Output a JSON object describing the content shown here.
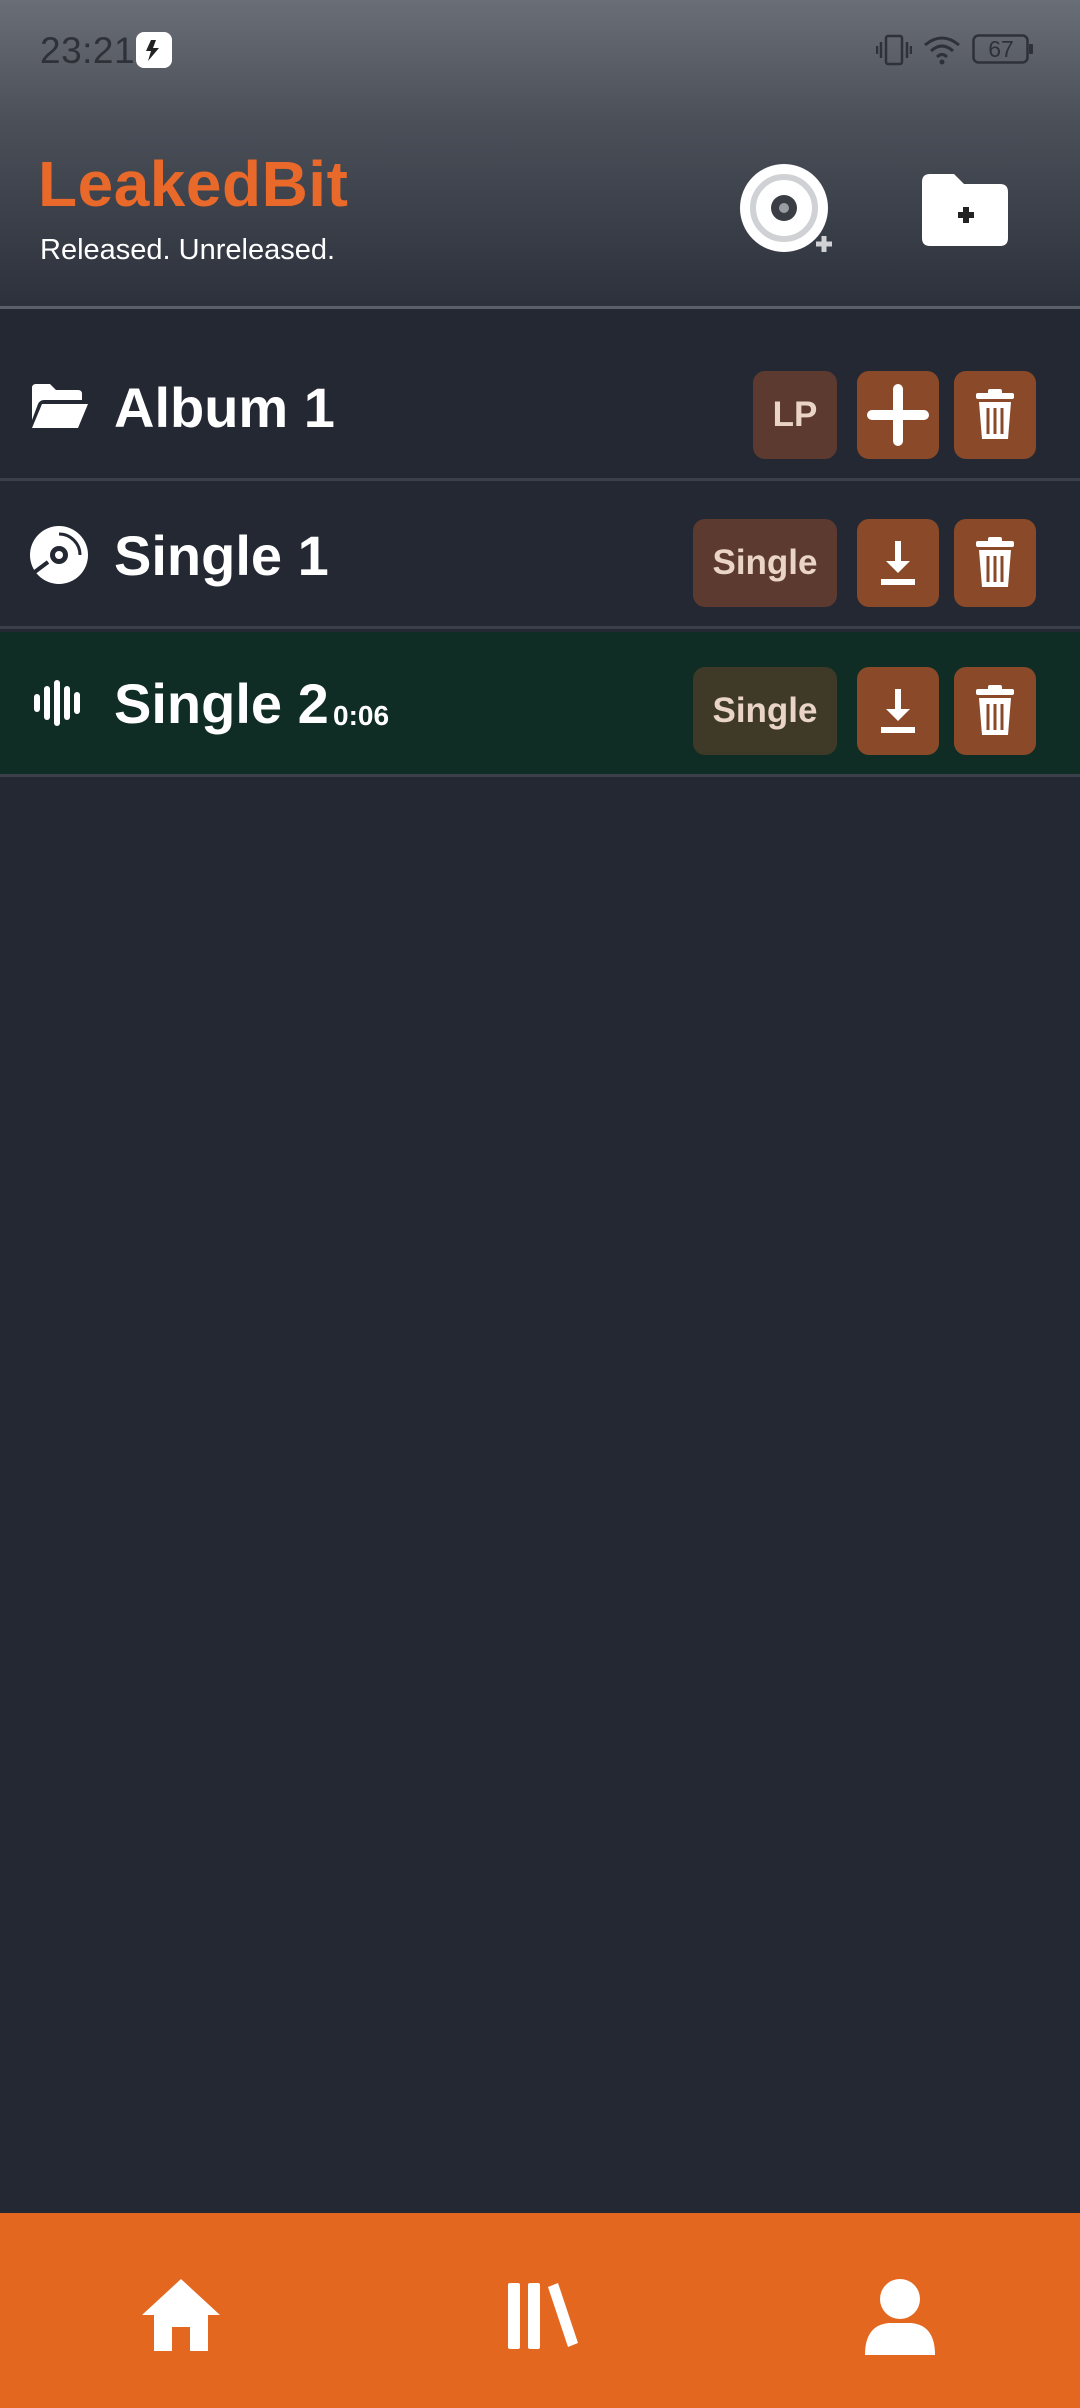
{
  "status_bar": {
    "time": "23:21",
    "battery": "67",
    "icons": [
      "app-notification-icon",
      "vibrate-icon",
      "wifi-icon",
      "battery-icon"
    ]
  },
  "header": {
    "title": "LeakedBit",
    "subtitle": "Released. Unreleased.",
    "actions": [
      "add-disc-icon",
      "add-folder-icon"
    ]
  },
  "colors": {
    "accent": "#e46720",
    "title": "#e9692a",
    "background": "#232833",
    "row_highlight": "#0f2d24",
    "action_button": "#8a4a29"
  },
  "items": [
    {
      "title": "Album 1",
      "badge": "LP",
      "icon": "folder-open-icon",
      "action": "add-icon",
      "duration": ""
    },
    {
      "title": "Single 1",
      "badge": "Single",
      "icon": "compact-disc-icon",
      "action": "download-icon",
      "duration": ""
    },
    {
      "title": "Single 2",
      "badge": "Single",
      "icon": "audio-wave-icon",
      "action": "download-icon",
      "duration": "0:06",
      "playing": true
    }
  ],
  "nav": [
    "home-icon",
    "library-icon",
    "profile-icon"
  ]
}
